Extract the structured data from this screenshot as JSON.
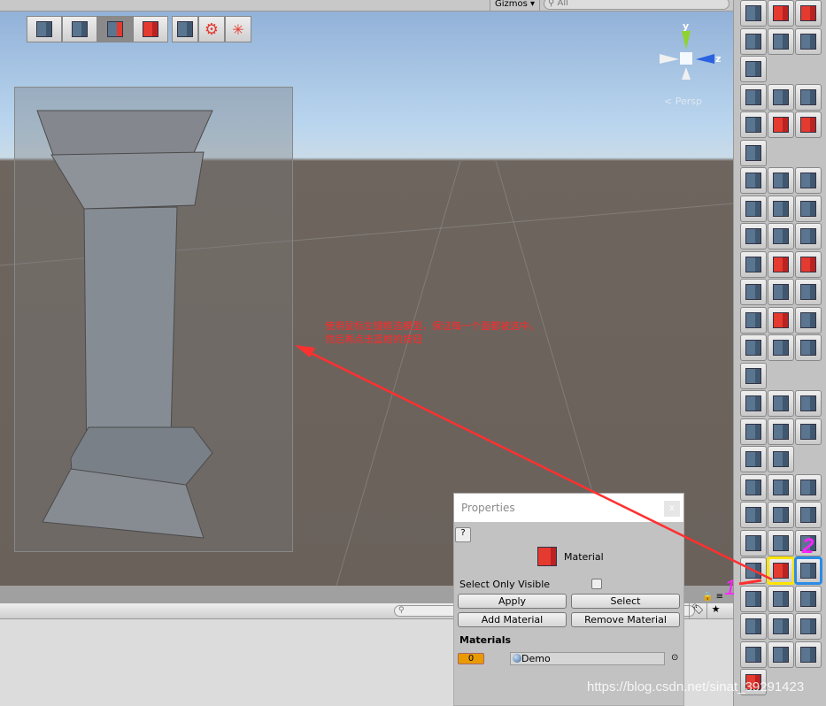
{
  "scene": {
    "gizmos_label": "Gizmos ▾",
    "search_placeholder": "All",
    "persp_label": "< Persp",
    "axis_y": "y",
    "axis_z": "z",
    "tool_groups": [
      [
        "select-object-icon",
        "select-vertex-icon",
        "select-edge-icon",
        "select-face-icon"
      ],
      [
        "new-shape-icon",
        "settings-icon",
        "center-pivot-icon"
      ]
    ],
    "active_tool_index": 2,
    "annotation_lines": [
      "使用鼠标左键框选模型，保证每一个面都被选中，",
      "然后再点击篮框的按钮"
    ],
    "annotation_color": "#ff2a2a"
  },
  "properties": {
    "title": "Properties",
    "close": "x",
    "help": "?",
    "header": "Material",
    "select_only_visible": "Select Only Visible",
    "select_only_visible_checked": false,
    "buttons": {
      "apply": "Apply",
      "select": "Select",
      "add": "Add Material",
      "remove": "Remove Material"
    },
    "materials_heading": "Materials",
    "materials": [
      {
        "index": "0",
        "name": "Demo"
      }
    ]
  },
  "bottom": {
    "tag": "🏷",
    "star": "★"
  },
  "marks": {
    "one": "1",
    "two": "2",
    "one_color": "#ff22ff",
    "two_color": "#ff22ff"
  },
  "rightbar": {
    "rows": [
      [
        "cube-select-icon",
        "poly-shape-icon",
        "detach-icon"
      ],
      [
        "mirror-icon",
        "mirror2-icon",
        "rotate-faces-icon"
      ],
      [
        "shape-icon"
      ],
      [
        "pen-icon",
        "line-icon",
        "arc-icon"
      ],
      [
        "spline-icon",
        "circle-icon",
        "stairs-icon"
      ],
      [
        "plane-icon"
      ],
      [
        "primitives-icon",
        "cube-icon",
        "cube2-icon"
      ],
      [
        "stair-icon",
        "cylinder-icon",
        "cone-icon"
      ],
      [
        "sphere-gen-icon",
        "sphere-icon",
        "capsule-icon"
      ],
      [
        "torus-icon",
        "extrude-up-icon",
        "extrude-face-icon"
      ],
      [
        "extrude-edge-icon",
        "flip-icon",
        "merge-icon"
      ],
      [
        "subdivide-icon",
        "bevel-icon",
        "bridge-icon"
      ],
      [
        "conform-icon",
        "color-face-icon",
        "grid-icon"
      ],
      [
        "triangulate-icon"
      ],
      [
        "eraser-icon",
        "smooth-icon",
        "connect-icon"
      ],
      [
        "pivot-icon",
        "weld-icon",
        "split-icon"
      ],
      [
        "uv-project-icon",
        "snap-icon"
      ],
      [
        "gear-icon",
        "boolean-icon",
        "cylinder-select-icon"
      ],
      [
        "vertex-grid-icon",
        "bend-icon",
        "axis-move-icon"
      ],
      [
        "corner-icon",
        "hierarchy-icon",
        "uv-edit-icon"
      ],
      [
        "vertex-color-icon",
        "material-cube-icon",
        "uv-editor-icon"
      ],
      [
        "shift-icon",
        "shift2-icon",
        "cylinder-outline-icon"
      ],
      [
        "snap-grid-icon",
        "add-cube-icon",
        "rotate-cube-icon"
      ],
      [
        "collapse-icon",
        "duplicate-icon",
        "export-icon"
      ],
      [
        "settings-gear-icon"
      ]
    ],
    "highlight_yellow": "material-cube-icon",
    "highlight_blue": "uv-editor-icon",
    "red_icons": [
      "poly-shape-icon",
      "detach-icon",
      "stairs-icon",
      "extrude-up-icon",
      "extrude-face-icon",
      "material-cube-icon",
      "settings-gear-icon",
      "circle-icon",
      "bevel-icon"
    ]
  },
  "watermark": "https://blog.csdn.net/sinat_39291423"
}
